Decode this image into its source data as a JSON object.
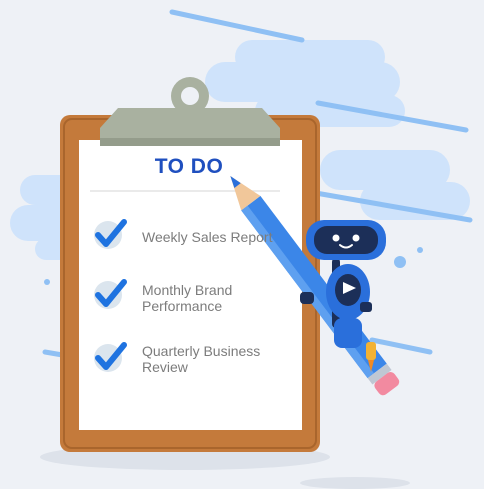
{
  "clipboard": {
    "title": "TO DO",
    "tasks": [
      {
        "label": "Weekly Sales Report",
        "checked": true
      },
      {
        "label": "Monthly Brand Performance",
        "checked": true
      },
      {
        "label": "Quarterly Business Review",
        "checked": true
      }
    ]
  },
  "icons": [
    "checkmark-icon",
    "pencil-icon",
    "robot-mascot"
  ],
  "colors": {
    "background": "#eef1f6",
    "cloud": "#cfe3fb",
    "board": "#c47a3b",
    "clip": "#a9b1a0",
    "title": "#1f4fbf",
    "check_blue": "#1f73e0",
    "pencil_blue": "#3b86e8",
    "robot_blue": "#2a6fdb"
  }
}
